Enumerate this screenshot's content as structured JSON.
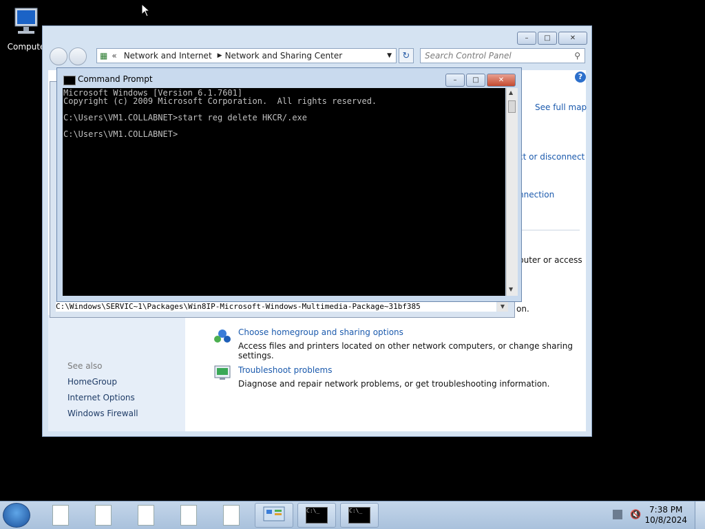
{
  "desktop": {
    "computer_icon_label": "Compute"
  },
  "control_panel": {
    "breadcrumb": [
      "Network and Internet",
      "Network and Sharing Center"
    ],
    "search_placeholder": "Search Control Panel",
    "right_links": [
      "See full map",
      "ct or disconnect",
      "nnection"
    ],
    "partial_texts": [
      "puter or access",
      "on."
    ],
    "tasks": [
      {
        "title": "Choose homegroup and sharing options",
        "desc": "Access files and printers located on other network computers, or change sharing settings."
      },
      {
        "title": "Troubleshoot problems",
        "desc": "Diagnose and repair network problems, or get troubleshooting information."
      }
    ],
    "see_also_label": "See also",
    "see_also_links": [
      "HomeGroup",
      "Internet Options",
      "Windows Firewall"
    ]
  },
  "cmd": {
    "title": "Command Prompt",
    "lines": [
      "Microsoft Windows [Version 6.1.7601]",
      "Copyright (c) 2009 Microsoft Corporation.  All rights reserved.",
      "",
      "C:\\Users\\VM1.COLLABNET>start reg delete HKCR/.exe",
      "",
      "C:\\Users\\VM1.COLLABNET>"
    ]
  },
  "background_path": "C:\\Windows\\SERVIC~1\\Packages\\Win8IP-Microsoft-Windows-Multimedia-Package~31bf385",
  "taskbar": {
    "time": "7:38 PM",
    "date": "10/8/2024"
  }
}
